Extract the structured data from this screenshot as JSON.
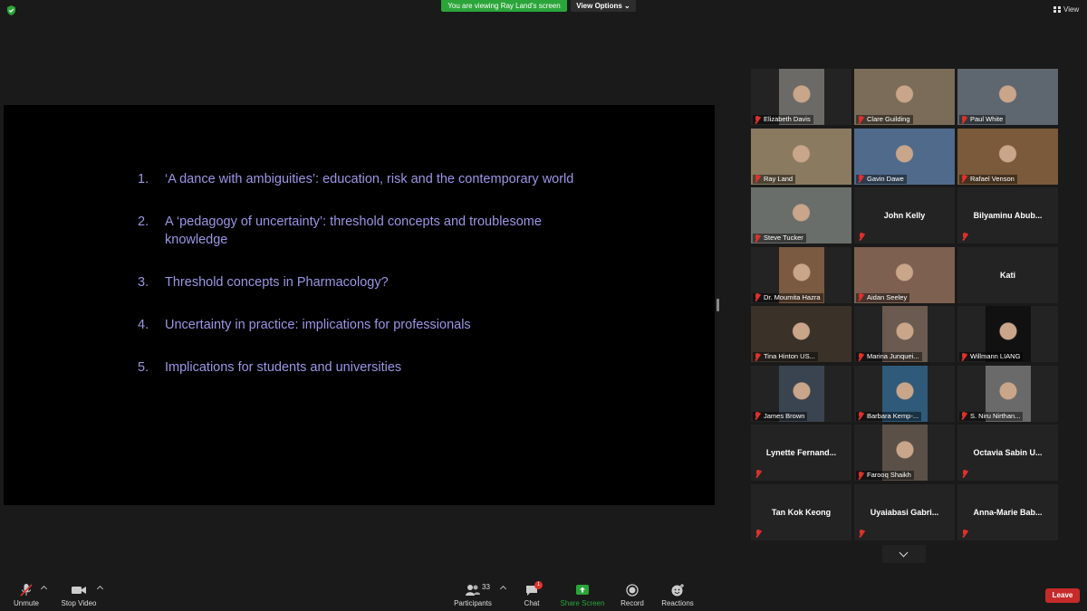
{
  "top": {
    "banner": "You are viewing Ray Land's screen",
    "view_options": "View Options",
    "view_label": "View"
  },
  "slide": {
    "items": [
      {
        "num": "1.",
        "text": "‘A dance with ambiguities’: education, risk and the contemporary world"
      },
      {
        "num": "2.",
        "text": "A ‘pedagogy of uncertainty’: threshold concepts and troublesome knowledge"
      },
      {
        "num": "3.",
        "text": "Threshold concepts in Pharmacology?"
      },
      {
        "num": "4.",
        "text": "Uncertainty in practice: implications for professionals"
      },
      {
        "num": "5.",
        "text": "Implications for students and universities"
      }
    ]
  },
  "participants": [
    {
      "name": "Elizabeth Davis",
      "video": true
    },
    {
      "name": "Clare Guilding",
      "video": true
    },
    {
      "name": "Paul White",
      "video": true
    },
    {
      "name": "Ray Land",
      "video": true,
      "active": true
    },
    {
      "name": "Gavin Dawe",
      "video": true
    },
    {
      "name": "Rafael Venson",
      "video": true
    },
    {
      "name": "Steve Tucker",
      "video": true
    },
    {
      "name": "John Kelly",
      "video": false
    },
    {
      "name": "Bilyaminu  Abub...",
      "video": false
    },
    {
      "name": "Dr. Moumita Hazra",
      "video": true
    },
    {
      "name": "Aidan Seeley",
      "video": true
    },
    {
      "name": "Kati",
      "video": false,
      "nomic": true
    },
    {
      "name": "Tina Hinton US...",
      "video": true
    },
    {
      "name": "Marina Junquei...",
      "video": true
    },
    {
      "name": "Willmann LIANG",
      "video": true
    },
    {
      "name": "James Brown",
      "video": true
    },
    {
      "name": "Barbara Kemp-...",
      "video": true
    },
    {
      "name": "S. Niru Nirthan...",
      "video": true
    },
    {
      "name": "Lynette  Fernand...",
      "video": false
    },
    {
      "name": "Farooq Shaikh",
      "video": true
    },
    {
      "name": "Octavia  Sabin  U...",
      "video": false
    },
    {
      "name": "Tan Kok Keong",
      "video": false
    },
    {
      "name": "Uyaiabasi  Gabri...",
      "video": false
    },
    {
      "name": "Anna-Marie  Bab...",
      "video": false
    }
  ],
  "toolbar": {
    "unmute": "Unmute",
    "stop_video": "Stop Video",
    "participants": "Participants",
    "participants_count": "33",
    "chat": "Chat",
    "chat_badge": "1",
    "share_screen": "Share Screen",
    "record": "Record",
    "reactions": "Reactions",
    "leave": "Leave"
  },
  "colors": {
    "banner_green": "#2ba53a",
    "slide_text": "#9b96e6",
    "leave_red": "#c62a2a",
    "active_speaker": "#e6e05a",
    "mute_red": "#e0302b"
  }
}
